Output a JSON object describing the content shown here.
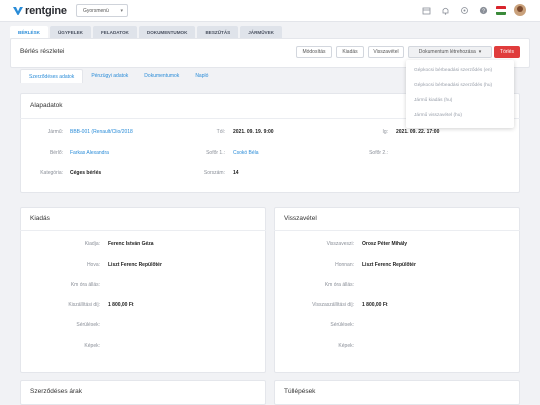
{
  "app": {
    "logo_text": "rentgine"
  },
  "topbar": {
    "quickmenu_label": "Gyorsmenü",
    "icons": [
      "calendar-icon",
      "bell-icon",
      "gear-icon",
      "help-icon",
      "flag-hu-icon",
      "avatar"
    ],
    "flag_colors": [
      "#d8242c",
      "#ffffff",
      "#3a8a3a"
    ]
  },
  "nav": {
    "tabs": [
      {
        "label": "Bérlésk",
        "active": true
      },
      {
        "label": "Ügyfelek",
        "active": false
      },
      {
        "label": "Feladatok",
        "active": false
      },
      {
        "label": "Dokumentumok",
        "active": false
      },
      {
        "label": "Beszűtás",
        "active": false
      },
      {
        "label": "Járművek",
        "active": false
      }
    ]
  },
  "page": {
    "title": "Bérlés részletei",
    "buttons": {
      "edit": "Módosítás",
      "handover": "Kiadás",
      "return": "Visszavétel",
      "create_doc": "Dokumentum létrehozása",
      "delete": "Törlés"
    }
  },
  "doc_dropdown": {
    "items": [
      "Gépkocsi bérbeadási szerződés (en)",
      "Gépkocsi bérbeadási szerződés (hu)",
      "Jármű kiadás (hu)",
      "Jármű visszavétel (hu)"
    ]
  },
  "subtabs": [
    {
      "label": "Szerződéses adatok",
      "active": true
    },
    {
      "label": "Pénzügyi adatok",
      "active": false
    },
    {
      "label": "Dokumentumok",
      "active": false
    },
    {
      "label": "Napló",
      "active": false
    }
  ],
  "basic": {
    "title": "Alapadatok",
    "vehicle_label": "Jármű:",
    "vehicle_value": "BBB-001 (Renault/Clio/2018",
    "from_label": "Tól:",
    "from_value": "2021. 09. 19. 9:00",
    "to_label": "Ig:",
    "to_value": "2021. 09. 22. 17:00",
    "renter_label": "Bérlő:",
    "renter_value": "Farkas Alexandra",
    "driver1_label": "Sofőr 1.:",
    "driver1_value": "Csokó Béla",
    "driver2_label": "Sofőr 2.:",
    "driver2_value": "",
    "category_label": "Kategória:",
    "category_value": "Céges bérlés",
    "serial_label": "Sorszám:",
    "serial_value": "14"
  },
  "handover": {
    "title": "Kiadás",
    "rows": [
      {
        "label": "Kiadja:",
        "value": "Ferenc István Géza"
      },
      {
        "label": "Hova:",
        "value": "Liszt Ferenc Repülőtér"
      },
      {
        "label": "Km óra állás:",
        "value": ""
      },
      {
        "label": "Kiszállítási díj:",
        "value": "1 800,00 Ft"
      },
      {
        "label": "Sérülések:",
        "value": ""
      },
      {
        "label": "Képek:",
        "value": ""
      }
    ]
  },
  "return_card": {
    "title": "Visszavétel",
    "rows": [
      {
        "label": "Visszaveszi:",
        "value": "Orosz Péter Mihály"
      },
      {
        "label": "Honnan:",
        "value": "Liszt Ferenc Repülőtér"
      },
      {
        "label": "Km óra állás:",
        "value": ""
      },
      {
        "label": "Visszaszállítási díj:",
        "value": "1 800,00 Ft"
      },
      {
        "label": "Sérülések:",
        "value": ""
      },
      {
        "label": "Képek:",
        "value": ""
      }
    ]
  },
  "bottom": {
    "prices_title": "Szerződéses árak",
    "overruns_title": "Túllépések"
  },
  "colors": {
    "accent": "#2a8cd8",
    "danger": "#e03c3c"
  }
}
